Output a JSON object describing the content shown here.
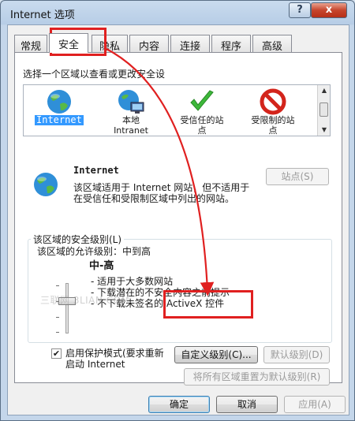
{
  "window": {
    "title": "Internet 选项",
    "help": "?",
    "close": "x"
  },
  "tabs": [
    {
      "label": "常规"
    },
    {
      "label": "安全"
    },
    {
      "label": "隐私"
    },
    {
      "label": "内容"
    },
    {
      "label": "连接"
    },
    {
      "label": "程序"
    },
    {
      "label": "高级"
    }
  ],
  "security": {
    "select_zone_label": "选择一个区域以查看或更改安全设",
    "zones": [
      {
        "label": "Internet",
        "icon": "globe-icon"
      },
      {
        "label": "本地\nIntranet",
        "icon": "intranet-icon"
      },
      {
        "label": "受信任的站\n点",
        "icon": "checkmark-icon"
      },
      {
        "label": "受限制的站\n点",
        "icon": "restricted-icon"
      }
    ],
    "zone_name": "Internet",
    "zone_desc_1": "该区域适用于 Internet 网站，但不适用于",
    "zone_desc_2": "在受信任和受限制区域中列出的网站。",
    "sites_button": "站点(S)",
    "level_group_label": "该区域的安全级别(L)",
    "allowed_levels": "该区域的允许级别：中到高",
    "level_name": "中-高",
    "level_desc_1": "- 适用于大多数网站",
    "level_desc_2": "- 下载潜在的不安全内容之前提示",
    "level_desc_3": "- 不下载未签名的 ActiveX 控件",
    "protected_mode_1": "启用保护模式(要求重新",
    "protected_mode_2": "启动 Internet",
    "protected_mode_checked": true,
    "custom_level_button": "自定义级别(C)...",
    "default_level_button": "默认级别(D)",
    "reset_all_button": "将所有区域重置为默认级别(R)"
  },
  "footer": {
    "ok": "确定",
    "cancel": "取消",
    "apply": "应用(A)"
  },
  "watermark": "三联网 3LIAN.COM",
  "colors": {
    "annotation_red": "#e02020",
    "selection_blue": "#3399ff"
  }
}
